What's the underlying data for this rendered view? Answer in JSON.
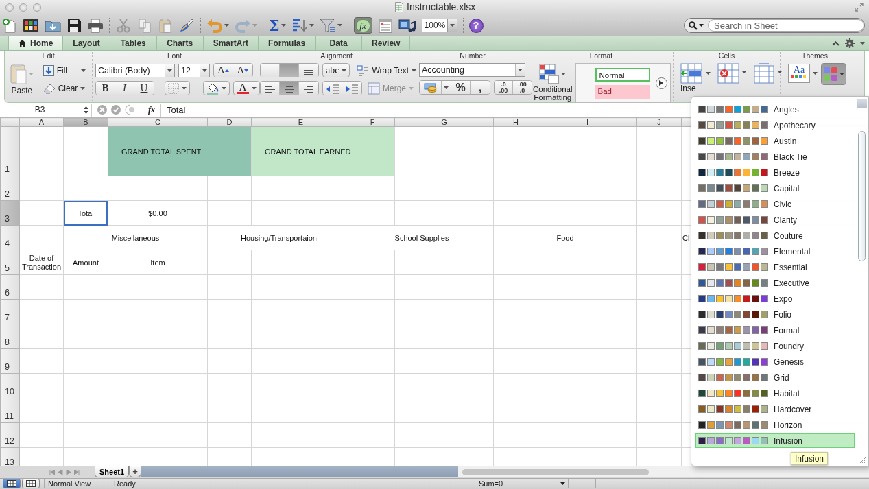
{
  "window": {
    "title": "Instructable.xlsx"
  },
  "toolbar": {
    "autosum": "Σ",
    "formula_builder": "fx",
    "zoom": "100%",
    "help": "?",
    "search": {
      "placeholder": "Search in Sheet"
    }
  },
  "ribbon_tabs": [
    {
      "label": "Home",
      "selected": true
    },
    {
      "label": "Layout",
      "selected": false
    },
    {
      "label": "Tables",
      "selected": false
    },
    {
      "label": "Charts",
      "selected": false
    },
    {
      "label": "SmartArt",
      "selected": false
    },
    {
      "label": "Formulas",
      "selected": false
    },
    {
      "label": "Data",
      "selected": false
    },
    {
      "label": "Review",
      "selected": false
    }
  ],
  "ribbon": {
    "edit": {
      "title": "Edit",
      "paste": "Paste",
      "fill": "Fill",
      "clear": "Clear"
    },
    "font": {
      "title": "Font",
      "name": "Calibri (Body)",
      "size": "12",
      "bold": "B",
      "italic": "I",
      "underline": "U",
      "grow": "A",
      "shrink": "A",
      "font_color_label": "A"
    },
    "alignment": {
      "title": "Alignment",
      "vertical": [
        {
          "selected": false
        },
        {
          "selected": true
        },
        {
          "selected": false
        }
      ],
      "horizontal": [
        {
          "selected": false
        },
        {
          "selected": true
        },
        {
          "selected": false
        }
      ],
      "orientation": "abc",
      "wrap_text": "Wrap Text",
      "merge": {
        "label": "Merge",
        "disabled": true
      }
    },
    "number": {
      "title": "Number",
      "format": "Accounting",
      "percent": "%",
      "comma": ",",
      "decimals": [
        {
          "top": ".0",
          "bottom": ".00"
        },
        {
          "top": ".00",
          "bottom": ".0"
        }
      ]
    },
    "format": {
      "title": "Format",
      "conditional": "Conditional Formatting",
      "styles": [
        {
          "label": "Normal",
          "kind": "normal"
        },
        {
          "label": "Bad",
          "kind": "bad"
        }
      ]
    },
    "cells": {
      "title": "Cells",
      "insert": "Inse"
    },
    "themes": {
      "title": "Themes",
      "fonts_sample": "Aa"
    }
  },
  "formula_bar": {
    "name_box": "B3",
    "fx": "fx",
    "formula": "Total"
  },
  "sheet": {
    "columns": [
      "A",
      "B",
      "C",
      "D",
      "E",
      "F",
      "G",
      "H",
      "I",
      "J"
    ],
    "rows": [
      {
        "number": "1",
        "cells": [
          null,
          null,
          {
            "text": "GRAND TOTAL SPENT",
            "color": "#8fc4b1",
            "merge_right": true,
            "selected": false
          },
          {
            "text": "GRAND TOTAL EARNED",
            "color": "#c1e6c8",
            "merge_right": true,
            "selected": false
          }
        ]
      },
      {
        "number": "2"
      },
      {
        "number": "3",
        "cells": [
          null,
          {
            "text": "Total",
            "selected": true
          },
          {
            "text": "$0.00",
            "selected": false
          }
        ]
      },
      {
        "number": "4",
        "cells": [
          null,
          {
            "text": "Miscellaneous",
            "merge_right": true,
            "selected": false
          },
          {
            "text": "Housing/Transportaion",
            "merge_right": true,
            "selected": false
          },
          {
            "text": "School Supplies",
            "merge_right": true,
            "selected": false
          },
          {
            "text": "Food",
            "merge_right": true,
            "selected": false
          },
          null,
          {
            "text": "Cl",
            "selected": false
          }
        ]
      },
      {
        "number": "5",
        "cells": [
          {
            "text": "Date of Transaction",
            "selected": false
          },
          {
            "text": "Amount",
            "selected": false
          },
          {
            "text": "Item",
            "selected": false
          }
        ]
      },
      {
        "number": "6"
      },
      {
        "number": "7"
      },
      {
        "number": "8"
      },
      {
        "number": "9"
      },
      {
        "number": "10"
      },
      {
        "number": "11"
      },
      {
        "number": "12"
      },
      {
        "number": "13"
      }
    ]
  },
  "theme_colors_menu": {
    "items": [
      {
        "name": "Angles",
        "selected": false,
        "swatches": [
          {
            "color": "#434343"
          },
          {
            "color": "#cfd9dc"
          },
          {
            "color": "#767676"
          },
          {
            "color": "#f7672a"
          },
          {
            "color": "#0ea2d8"
          },
          {
            "color": "#7a9a50"
          },
          {
            "color": "#c2ae8e"
          },
          {
            "color": "#456a92"
          }
        ]
      },
      {
        "name": "Apothecary",
        "selected": false,
        "swatches": [
          {
            "color": "#574a3e"
          },
          {
            "color": "#f0ecd1"
          },
          {
            "color": "#929f98"
          },
          {
            "color": "#d35545"
          },
          {
            "color": "#b8ad5a"
          },
          {
            "color": "#85825a"
          },
          {
            "color": "#e8b464"
          },
          {
            "color": "#7b6e70"
          }
        ]
      },
      {
        "name": "Austin",
        "selected": false,
        "swatches": [
          {
            "color": "#3e3d2d"
          },
          {
            "color": "#caf278"
          },
          {
            "color": "#94c23a"
          },
          {
            "color": "#766a60"
          },
          {
            "color": "#fa6326"
          },
          {
            "color": "#8e936a"
          },
          {
            "color": "#9a6540"
          },
          {
            "color": "#fb9e38"
          }
        ]
      },
      {
        "name": "Black Tie",
        "selected": false,
        "swatches": [
          {
            "color": "#474747"
          },
          {
            "color": "#e4ddd2"
          },
          {
            "color": "#747479"
          },
          {
            "color": "#a6b68c"
          },
          {
            "color": "#c3b29c"
          },
          {
            "color": "#8fa6b8"
          },
          {
            "color": "#9e8165"
          },
          {
            "color": "#906978"
          }
        ]
      },
      {
        "name": "Breeze",
        "selected": false,
        "swatches": [
          {
            "color": "#0e2741"
          },
          {
            "color": "#d0eef4"
          },
          {
            "color": "#227e9b"
          },
          {
            "color": "#1d4b57"
          },
          {
            "color": "#e87530"
          },
          {
            "color": "#fdb436"
          },
          {
            "color": "#76b231"
          },
          {
            "color": "#c4161c"
          }
        ]
      },
      {
        "name": "Capital",
        "selected": false,
        "swatches": [
          {
            "color": "#726f63"
          },
          {
            "color": "#788a90"
          },
          {
            "color": "#435258"
          },
          {
            "color": "#a04e3c"
          },
          {
            "color": "#524438"
          },
          {
            "color": "#c5a87a"
          },
          {
            "color": "#627058"
          },
          {
            "color": "#b9d8b4"
          }
        ]
      },
      {
        "name": "Civic",
        "selected": false,
        "swatches": [
          {
            "color": "#646b86"
          },
          {
            "color": "#c5d1d7"
          },
          {
            "color": "#d05e4a"
          },
          {
            "color": "#ccb02f"
          },
          {
            "color": "#8aadaa"
          },
          {
            "color": "#8e7b6f"
          },
          {
            "color": "#8fad8b"
          },
          {
            "color": "#d88f55"
          }
        ]
      },
      {
        "name": "Clarity",
        "selected": false,
        "swatches": [
          {
            "color": "#d65246"
          },
          {
            "color": "#f2f1dc"
          },
          {
            "color": "#93a299"
          },
          {
            "color": "#ad8f67"
          },
          {
            "color": "#726056"
          },
          {
            "color": "#4c5a6a"
          },
          {
            "color": "#808da0"
          },
          {
            "color": "#79463d"
          }
        ]
      },
      {
        "name": "Couture",
        "selected": false,
        "swatches": [
          {
            "color": "#37302a"
          },
          {
            "color": "#d0ccb9"
          },
          {
            "color": "#9e8e5c"
          },
          {
            "color": "#a09781"
          },
          {
            "color": "#85776d"
          },
          {
            "color": "#aeafa9"
          },
          {
            "color": "#8d878b"
          },
          {
            "color": "#6b6149"
          }
        ]
      },
      {
        "name": "Elemental",
        "selected": false,
        "swatches": [
          {
            "color": "#242852"
          },
          {
            "color": "#accbf9"
          },
          {
            "color": "#629dd1"
          },
          {
            "color": "#297fd5"
          },
          {
            "color": "#7f8fa9"
          },
          {
            "color": "#4a66ac"
          },
          {
            "color": "#5aa2ae"
          },
          {
            "color": "#9d90a0"
          }
        ]
      },
      {
        "name": "Essential",
        "selected": false,
        "swatches": [
          {
            "color": "#d81f3c"
          },
          {
            "color": "#c8c6b0"
          },
          {
            "color": "#7a7a7a"
          },
          {
            "color": "#f8c13b"
          },
          {
            "color": "#4c6cb1"
          },
          {
            "color": "#9ba2b3"
          },
          {
            "color": "#e65732"
          },
          {
            "color": "#b9b794"
          }
        ]
      },
      {
        "name": "Executive",
        "selected": false,
        "swatches": [
          {
            "color": "#2f5897"
          },
          {
            "color": "#e4e9ef"
          },
          {
            "color": "#6076b4"
          },
          {
            "color": "#9c5252"
          },
          {
            "color": "#e68422"
          },
          {
            "color": "#846648"
          },
          {
            "color": "#63891f"
          },
          {
            "color": "#758085"
          }
        ]
      },
      {
        "name": "Expo",
        "selected": false,
        "swatches": [
          {
            "color": "#233a88"
          },
          {
            "color": "#6ab8ee"
          },
          {
            "color": "#fbc02d"
          },
          {
            "color": "#f3e2a8"
          },
          {
            "color": "#fb8c2a"
          },
          {
            "color": "#c61b1b"
          },
          {
            "color": "#680f0f"
          },
          {
            "color": "#7b3cdb"
          }
        ]
      },
      {
        "name": "Folio",
        "selected": false,
        "swatches": [
          {
            "color": "#2c2c2c"
          },
          {
            "color": "#dfdcd2"
          },
          {
            "color": "#294171"
          },
          {
            "color": "#748cbc"
          },
          {
            "color": "#8e887c"
          },
          {
            "color": "#834736"
          },
          {
            "color": "#5a1705"
          },
          {
            "color": "#a0a16a"
          }
        ]
      },
      {
        "name": "Formal",
        "selected": false,
        "swatches": [
          {
            "color": "#3b3a48"
          },
          {
            "color": "#e3ddd0"
          },
          {
            "color": "#907f76"
          },
          {
            "color": "#a46645"
          },
          {
            "color": "#cd9c47"
          },
          {
            "color": "#9c92ac"
          },
          {
            "color": "#7f64a0"
          },
          {
            "color": "#7c3b7b"
          }
        ]
      },
      {
        "name": "Foundry",
        "selected": false,
        "swatches": [
          {
            "color": "#676a55"
          },
          {
            "color": "#eaebde"
          },
          {
            "color": "#72a376"
          },
          {
            "color": "#b0ccb0"
          },
          {
            "color": "#a8cdd7"
          },
          {
            "color": "#c0beaf"
          },
          {
            "color": "#cec597"
          },
          {
            "color": "#e8b7b7"
          }
        ]
      },
      {
        "name": "Genesis",
        "selected": false,
        "swatches": [
          {
            "color": "#455463"
          },
          {
            "color": "#bcdcf7"
          },
          {
            "color": "#80b73c"
          },
          {
            "color": "#eaa23b"
          },
          {
            "color": "#1a9bd8"
          },
          {
            "color": "#22ab9b"
          },
          {
            "color": "#5134b8"
          },
          {
            "color": "#8d3ed9"
          }
        ]
      },
      {
        "name": "Grid",
        "selected": false,
        "swatches": [
          {
            "color": "#534949"
          },
          {
            "color": "#ccd1b9"
          },
          {
            "color": "#c66951"
          },
          {
            "color": "#bf974d"
          },
          {
            "color": "#928b70"
          },
          {
            "color": "#87706b"
          },
          {
            "color": "#94734e"
          },
          {
            "color": "#6f777d"
          }
        ]
      },
      {
        "name": "Habitat",
        "selected": false,
        "swatches": [
          {
            "color": "#1e4737"
          },
          {
            "color": "#f2e9c4"
          },
          {
            "color": "#f8c235"
          },
          {
            "color": "#fa8627"
          },
          {
            "color": "#fe3023"
          },
          {
            "color": "#8b6c3e"
          },
          {
            "color": "#848a4a"
          },
          {
            "color": "#526221"
          }
        ]
      },
      {
        "name": "Hardcover",
        "selected": false,
        "swatches": [
          {
            "color": "#895d1d"
          },
          {
            "color": "#ece9c6"
          },
          {
            "color": "#873624"
          },
          {
            "color": "#d6862d"
          },
          {
            "color": "#d0be40"
          },
          {
            "color": "#877f6c"
          },
          {
            "color": "#972109"
          },
          {
            "color": "#aab38a"
          }
        ]
      },
      {
        "name": "Horizon",
        "selected": false,
        "swatches": [
          {
            "color": "#1f2123"
          },
          {
            "color": "#dc9e39"
          },
          {
            "color": "#7a96b1"
          },
          {
            "color": "#d1876a"
          },
          {
            "color": "#7a6a60"
          },
          {
            "color": "#b89775"
          },
          {
            "color": "#5e7271"
          },
          {
            "color": "#9d8c70"
          }
        ]
      },
      {
        "name": "Infusion",
        "selected": true,
        "swatches": [
          {
            "color": "#2b1d4c"
          },
          {
            "color": "#b8a9db"
          },
          {
            "color": "#8c6cc9"
          },
          {
            "color": "#c0e7cd"
          },
          {
            "color": "#c5a4e2"
          },
          {
            "color": "#b85cc3"
          },
          {
            "color": "#9ad9f1"
          },
          {
            "color": "#8fc2b1"
          }
        ]
      }
    ],
    "tooltip": "Infusion"
  },
  "sheet_tabs": {
    "tabs": [
      {
        "label": "Sheet1",
        "selected": true
      }
    ],
    "add": "+"
  },
  "status_bar": {
    "views": [
      {
        "selected": true
      },
      {
        "selected": false
      }
    ],
    "view_label": "Normal View",
    "state": "Ready",
    "sum": "Sum=0"
  }
}
